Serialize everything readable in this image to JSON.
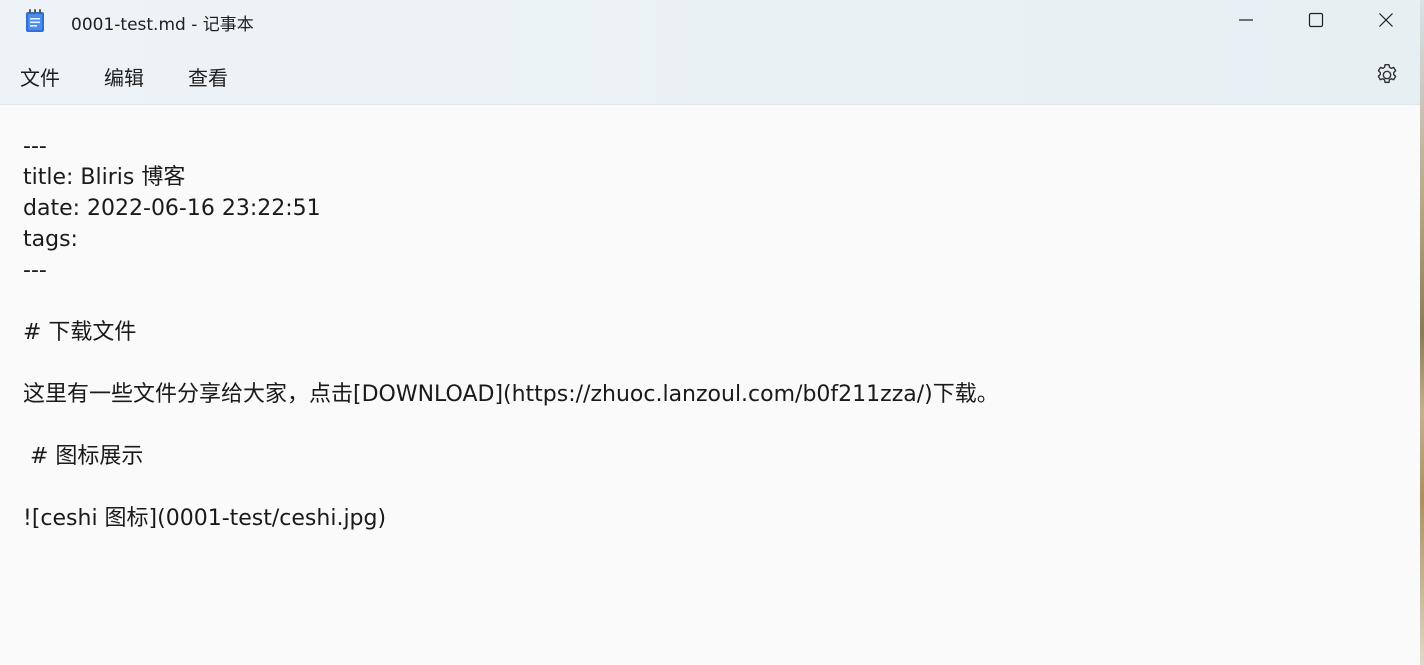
{
  "window": {
    "title": "0001-test.md - 记事本",
    "controls": {
      "minimize": "minimize-icon",
      "maximize": "maximize-icon",
      "close": "close-icon"
    }
  },
  "menu": {
    "file": "文件",
    "edit": "编辑",
    "view": "查看",
    "settings_icon": "gear-icon"
  },
  "document": {
    "lines": [
      "---",
      "title: Bliris 博客",
      "date: 2022-06-16 23:22:51",
      "tags:",
      "---",
      "",
      "# 下载文件",
      "",
      "这里有一些文件分享给大家，点击[DOWNLOAD](https://zhuoc.lanzoul.com/b0f211zza/)下载。",
      "",
      " # 图标展示",
      "",
      "![ceshi 图标](0001-test/ceshi.jpg)"
    ]
  },
  "colors": {
    "chrome_bg": "#eaf1f5",
    "editor_bg": "#fafafa",
    "text": "#1a1a1a",
    "notepad_icon": "#2f6fd6"
  }
}
